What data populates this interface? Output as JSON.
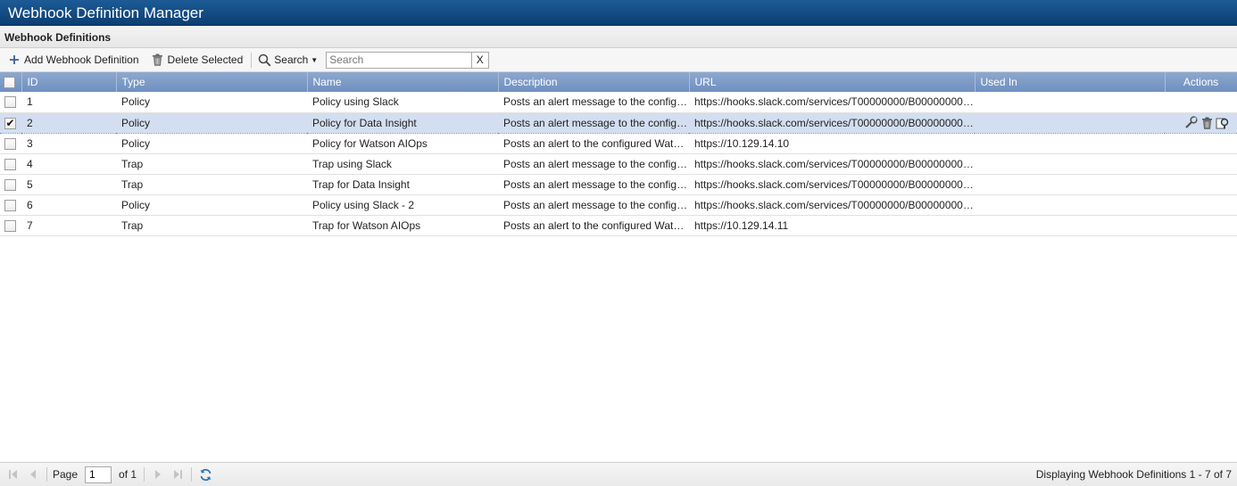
{
  "window": {
    "title": "Webhook Definition Manager"
  },
  "panel": {
    "title": "Webhook Definitions"
  },
  "toolbar": {
    "add_label": "Add Webhook Definition",
    "delete_label": "Delete Selected",
    "search_label": "Search",
    "search_placeholder": "Search",
    "search_value": "",
    "clear_label": "X"
  },
  "table": {
    "columns": {
      "id": "ID",
      "type": "Type",
      "name": "Name",
      "description": "Description",
      "url": "URL",
      "used_in": "Used In",
      "actions": "Actions"
    },
    "rows": [
      {
        "checked": false,
        "id": "1",
        "type": "Policy",
        "name": "Policy using Slack",
        "description": "Posts an alert message to the configure...",
        "url": "https://hooks.slack.com/services/T00000000/B00000000/XX...",
        "used_in": ""
      },
      {
        "checked": true,
        "id": "2",
        "type": "Policy",
        "name": "Policy for Data Insight",
        "description": "Posts an alert message to the configure...",
        "url": "https://hooks.slack.com/services/T00000000/B00000000/XX...",
        "used_in": ""
      },
      {
        "checked": false,
        "id": "3",
        "type": "Policy",
        "name": "Policy for Watson AIOps",
        "description": "Posts an alert to the configured Watson...",
        "url": "https://10.129.14.10",
        "used_in": ""
      },
      {
        "checked": false,
        "id": "4",
        "type": "Trap",
        "name": "Trap using Slack",
        "description": "Posts an alert message to the configure...",
        "url": "https://hooks.slack.com/services/T00000000/B00000000/XX...",
        "used_in": ""
      },
      {
        "checked": false,
        "id": "5",
        "type": "Trap",
        "name": "Trap for Data Insight",
        "description": "Posts an alert message to the configure...",
        "url": "https://hooks.slack.com/services/T00000000/B00000000/XX...",
        "used_in": ""
      },
      {
        "checked": false,
        "id": "6",
        "type": "Policy",
        "name": "Policy using Slack - 2",
        "description": "Posts an alert message to the configure...",
        "url": "https://hooks.slack.com/services/T00000000/B00000000/XX...",
        "used_in": ""
      },
      {
        "checked": false,
        "id": "7",
        "type": "Trap",
        "name": "Trap for Watson AIOps",
        "description": "Posts an alert to the configured Watson...",
        "url": "https://10.129.14.11",
        "used_in": ""
      }
    ]
  },
  "pager": {
    "page_label": "Page",
    "page_value": "1",
    "of_label": "of 1",
    "status": "Displaying Webhook Definitions 1 - 7 of 7"
  },
  "colors": {
    "title_bar": "#0d3f73",
    "header_row": "#7b9ac7",
    "selected_row": "#d3dff0"
  }
}
